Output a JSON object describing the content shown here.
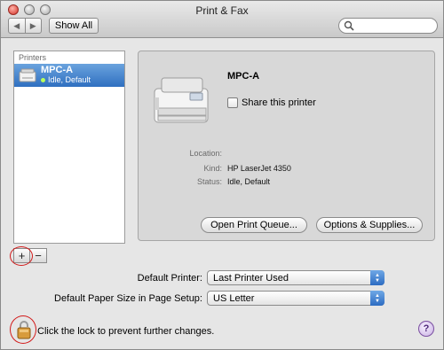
{
  "window": {
    "title": "Print & Fax"
  },
  "toolbar": {
    "show_all_label": "Show All",
    "search": {
      "value": "",
      "placeholder": ""
    }
  },
  "printers_list": {
    "header": "Printers",
    "items": [
      {
        "name": "MPC-A",
        "status": "Idle, Default",
        "status_color": "#b8ff5b"
      }
    ]
  },
  "detail": {
    "printer_name": "MPC-A",
    "share_label": "Share this printer",
    "share_checked": false,
    "location_label": "Location:",
    "location_value": "",
    "kind_label": "Kind:",
    "kind_value": "HP LaserJet 4350",
    "status_label": "Status:",
    "status_value": "Idle, Default",
    "open_queue_label": "Open Print Queue...",
    "options_label": "Options & Supplies..."
  },
  "list_controls": {
    "add_label": "+",
    "remove_label": "−"
  },
  "settings": {
    "default_printer_label": "Default Printer:",
    "default_printer_value": "Last Printer Used",
    "paper_size_label": "Default Paper Size in Page Setup:",
    "paper_size_value": "US Letter"
  },
  "footer": {
    "lock_text": "Click the lock to prevent further changes.",
    "help_label": "?"
  },
  "colors": {
    "selection": "#2f6fc0",
    "annotation_circle": "#d21a1a",
    "popup_arrow": "#2d6cc2"
  }
}
